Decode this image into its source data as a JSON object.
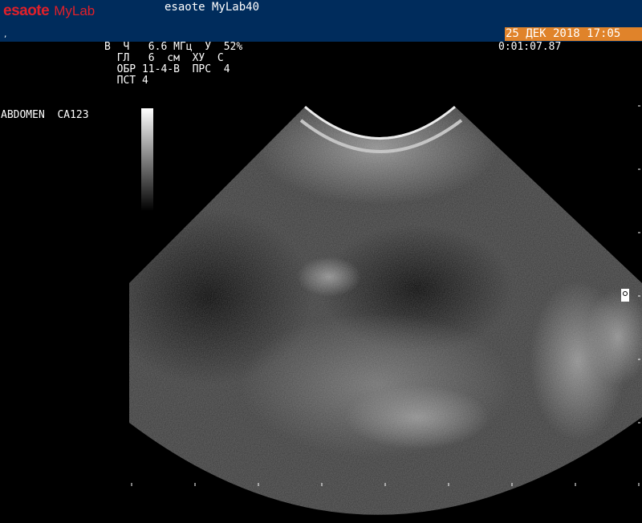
{
  "header": {
    "brand": "esaote",
    "product": "MyLab",
    "device_name": "esaote MyLab40",
    "small_mark": ",",
    "datetime": "25 ДЕК 2018 17:05"
  },
  "params": {
    "row1": "В  Ч   6.6 МГц  У  52%",
    "row2": "  ГЛ   6  см  ХУ  С",
    "row3": "  ОБР 11-4-В  ПРС  4",
    "row4": "  ПСТ 4"
  },
  "timer": "0:01:07.87",
  "preset": "ABDOMEN  CA123",
  "colors": {
    "header_bg": "#002c5c",
    "brand_red": "#e0202a",
    "datetime_bg": "#e0832a"
  }
}
